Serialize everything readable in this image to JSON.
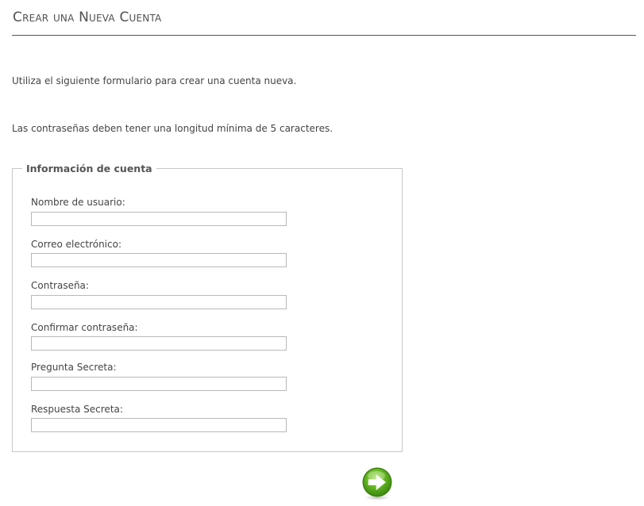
{
  "page": {
    "title": "Crear una Nueva Cuenta",
    "intro_text": "Utiliza el siguiente formulario para crear una cuenta nueva.",
    "password_note": "Las contraseñas deben tener una longitud mínima de 5 caracteres."
  },
  "form": {
    "legend": "Información de cuenta",
    "fields": [
      {
        "label": "Nombre de usuario:",
        "value": ""
      },
      {
        "label": "Correo electrónico:",
        "value": ""
      },
      {
        "label": "Contraseña:",
        "value": ""
      },
      {
        "label": "Confirmar contraseña:",
        "value": ""
      },
      {
        "label": "Pregunta Secreta:",
        "value": ""
      },
      {
        "label": "Respuesta Secreta:",
        "value": ""
      }
    ],
    "submit": {
      "icon": "arrow-right-icon",
      "color": "#5cae1d"
    }
  }
}
